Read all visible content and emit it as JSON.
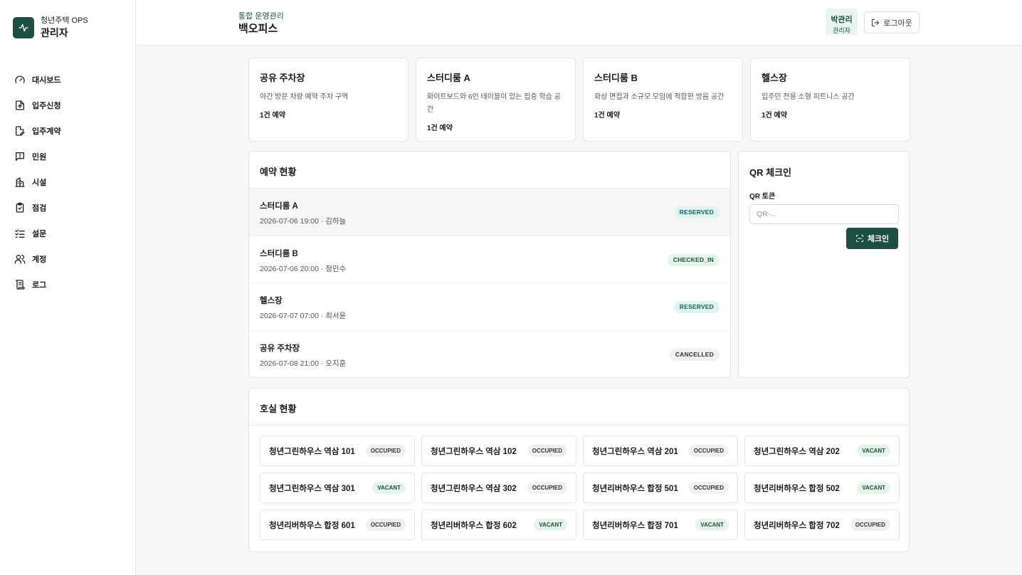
{
  "brand": {
    "subtitle": "청년주택 OPS",
    "title": "관리자"
  },
  "sidebar": {
    "items": [
      {
        "label": "대시보드",
        "icon": "gauge-icon"
      },
      {
        "label": "입주신청",
        "icon": "file-upload-icon"
      },
      {
        "label": "입주계약",
        "icon": "file-edit-icon"
      },
      {
        "label": "민원",
        "icon": "message-alert-icon"
      },
      {
        "label": "시설",
        "icon": "building-icon"
      },
      {
        "label": "점검",
        "icon": "clipboard-check-icon"
      },
      {
        "label": "설문",
        "icon": "list-checks-icon"
      },
      {
        "label": "계정",
        "icon": "users-icon"
      },
      {
        "label": "로그",
        "icon": "scroll-icon"
      }
    ]
  },
  "header": {
    "subtitle": "통합 운영관리",
    "title": "백오피스",
    "user_name": "박관리",
    "user_role": "관리자",
    "logout_label": "로그아웃"
  },
  "facilities": [
    {
      "title": "공유 주차장",
      "desc": "야간 방문 차량 예약 주차 구역",
      "count": "1건 예약"
    },
    {
      "title": "스터디룸 A",
      "desc": "화이트보드와 6인 테이블이 있는 집중 학습 공간",
      "count": "1건 예약"
    },
    {
      "title": "스터디룸 B",
      "desc": "화상 면접과 소규모 모임에 적합한 방음 공간",
      "count": "1건 예약"
    },
    {
      "title": "헬스장",
      "desc": "입주민 전용 소형 피트니스 공간",
      "count": "1건 예약"
    }
  ],
  "reservations": {
    "title": "예약 현황",
    "rows": [
      {
        "name": "스터디룸 A",
        "meta": "2026-07-06 19:00 · 김하늘",
        "status": "RESERVED"
      },
      {
        "name": "스터디룸 B",
        "meta": "2026-07-06 20:00 · 정민수",
        "status": "CHECKED_IN"
      },
      {
        "name": "헬스장",
        "meta": "2026-07-07 07:00 · 최서윤",
        "status": "RESERVED"
      },
      {
        "name": "공유 주차장",
        "meta": "2026-07-08 21:00 · 오지훈",
        "status": "CANCELLED"
      }
    ]
  },
  "qr": {
    "title": "QR 체크인",
    "label": "QR 토큰",
    "placeholder": "QR-...",
    "value": "",
    "button_label": "체크인"
  },
  "rooms": {
    "title": "호실 현황",
    "items": [
      {
        "name": "청년그린하우스 역삼 101",
        "status": "OCCUPIED"
      },
      {
        "name": "청년그린하우스 역삼 102",
        "status": "OCCUPIED"
      },
      {
        "name": "청년그린하우스 역삼 201",
        "status": "OCCUPIED"
      },
      {
        "name": "청년그린하우스 역삼 202",
        "status": "VACANT"
      },
      {
        "name": "청년그린하우스 역삼 301",
        "status": "VACANT"
      },
      {
        "name": "청년그린하우스 역삼 302",
        "status": "OCCUPIED"
      },
      {
        "name": "청년리버하우스 합정 501",
        "status": "OCCUPIED"
      },
      {
        "name": "청년리버하우스 합정 502",
        "status": "VACANT"
      },
      {
        "name": "청년리버하우스 합정 601",
        "status": "OCCUPIED"
      },
      {
        "name": "청년리버하우스 합정 602",
        "status": "VACANT"
      },
      {
        "name": "청년리버하우스 합정 701",
        "status": "VACANT"
      },
      {
        "name": "청년리버하우스 합정 702",
        "status": "OCCUPIED"
      }
    ]
  },
  "colors": {
    "brand": "#1e4d43",
    "badge_reserved_bg": "#dff5f1",
    "badge_vacant_bg": "#e4f5ea"
  }
}
